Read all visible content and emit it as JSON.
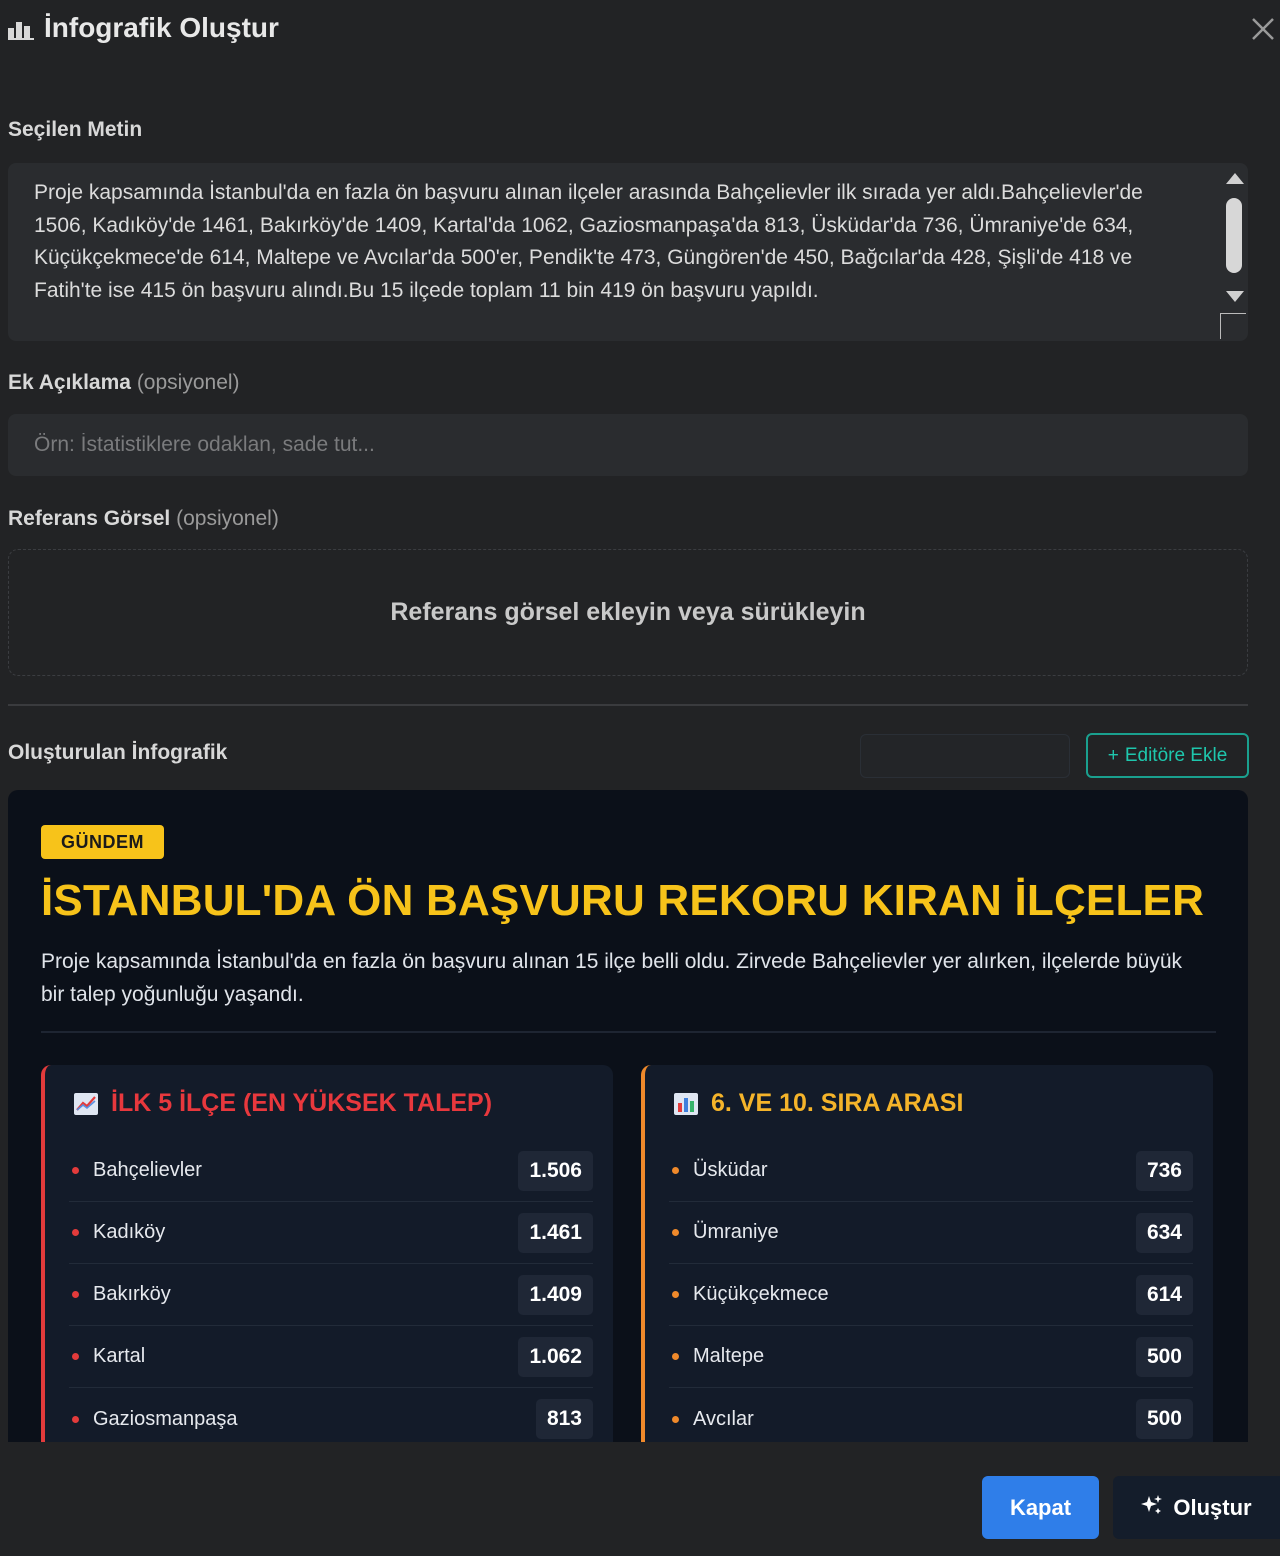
{
  "dialog": {
    "title": "İnfografik Oluştur"
  },
  "selected_text": {
    "label": "Seçilen Metin",
    "value": "Proje kapsamında İstanbul'da en fazla ön başvuru alınan ilçeler arasında Bahçelievler ilk sırada yer aldı.Bahçelievler'de 1506, Kadıköy'de 1461, Bakırköy'de 1409, Kartal'da 1062, Gaziosmanpaşa'da 813, Üsküdar'da 736, Ümraniye'de 634, Küçükçekmece'de 614, Maltepe ve Avcılar'da 500'er, Pendik'te 473, Güngören'de 450, Bağcılar'da 428, Şişli'de 418 ve Fatih'te ise 415 ön başvuru alındı.Bu 15 ilçede toplam 11 bin 419 ön başvuru yapıldı."
  },
  "extra_note": {
    "label": "Ek Açıklama",
    "optional": "(opsiyonel)",
    "placeholder": "Örn: İstatistiklere odaklan, sade tut...",
    "value": ""
  },
  "reference_image": {
    "label": "Referans Görsel",
    "optional": "(opsiyonel)",
    "dropzone_text": "Referans görsel ekleyin veya sürükleyin"
  },
  "result": {
    "label": "Oluşturulan İnfografik",
    "add_to_editor": "Editöre Ekle"
  },
  "infographic": {
    "badge": "GÜNDEM",
    "title": "İSTANBUL'DA ÖN BAŞVURU REKORU KIRAN İLÇELER",
    "description": "Proje kapsamında İstanbul'da en fazla ön başvuru alınan 15 ilçe belli oldu. Zirvede Bahçelievler yer alırken, ilçelerde büyük bir talep yoğunluğu yaşandı.",
    "left_panel": {
      "heading": "İLK 5 İLÇE (EN YÜKSEK TALEP)",
      "icon": "chart-increasing-icon",
      "accent": "#e33b3b",
      "rows": [
        {
          "name": "Bahçelievler",
          "value": "1.506"
        },
        {
          "name": "Kadıköy",
          "value": "1.461"
        },
        {
          "name": "Bakırköy",
          "value": "1.409"
        },
        {
          "name": "Kartal",
          "value": "1.062"
        },
        {
          "name": "Gaziosmanpaşa",
          "value": "813"
        }
      ]
    },
    "right_panel": {
      "heading": "6. VE 10. SIRA ARASI",
      "icon": "bar-chart-icon",
      "accent": "#f08a2b",
      "rows": [
        {
          "name": "Üsküdar",
          "value": "736"
        },
        {
          "name": "Ümraniye",
          "value": "634"
        },
        {
          "name": "Küçükçekmece",
          "value": "614"
        },
        {
          "name": "Maltepe",
          "value": "500"
        },
        {
          "name": "Avcılar",
          "value": "500"
        }
      ]
    }
  },
  "footer": {
    "close_label": "Kapat",
    "create_label": "Oluştur"
  },
  "colors": {
    "background": "#222325",
    "infographic_bg": "#0b1019",
    "accent_yellow": "#f7c31a",
    "accent_teal": "#1ec7ad",
    "primary_blue": "#2f7ee9"
  }
}
